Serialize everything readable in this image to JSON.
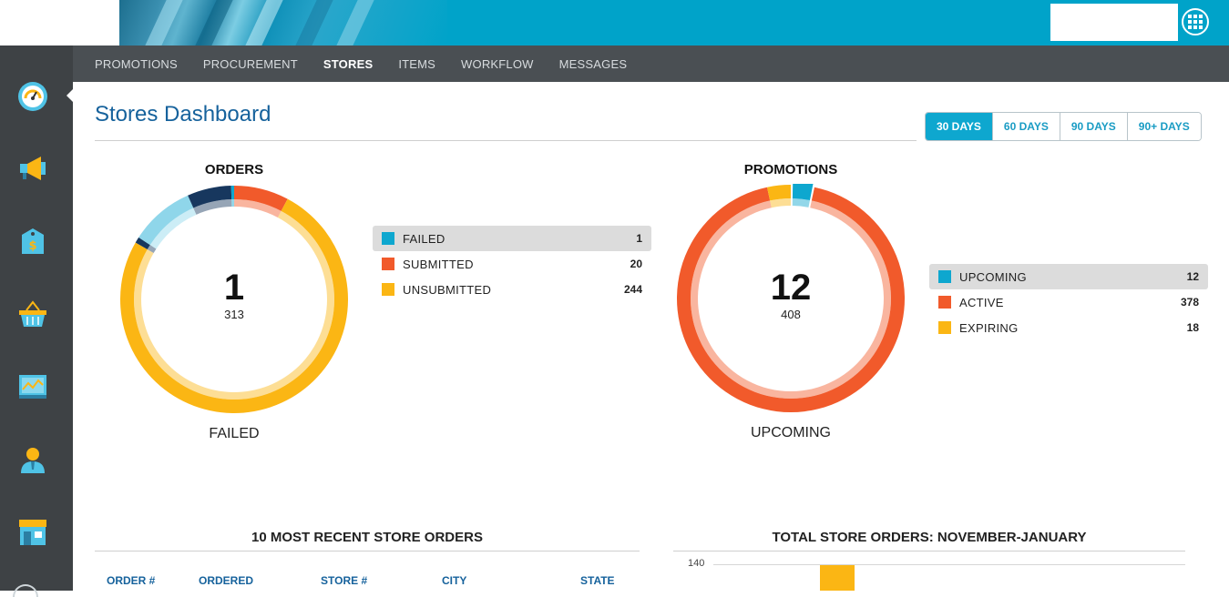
{
  "nav": {
    "items": [
      {
        "label": "PROMOTIONS",
        "active": false
      },
      {
        "label": "PROCUREMENT",
        "active": false
      },
      {
        "label": "STORES",
        "active": true
      },
      {
        "label": "ITEMS",
        "active": false
      },
      {
        "label": "WORKFLOW",
        "active": false
      },
      {
        "label": "MESSAGES",
        "active": false
      }
    ]
  },
  "sidebar": {
    "icons": [
      "dashboard-gauge-icon",
      "megaphone-icon",
      "price-tag-icon",
      "basket-icon",
      "chart-icon",
      "user-icon",
      "store-icon"
    ]
  },
  "page": {
    "title": "Stores Dashboard"
  },
  "range": {
    "options": [
      "30 DAYS",
      "60 DAYS",
      "90 DAYS",
      "90+ DAYS"
    ],
    "selected": "30 DAYS"
  },
  "colors": {
    "blue": "#0ea7cf",
    "orange": "#f15a2b",
    "yellow": "#fbb614",
    "navy": "#17375e",
    "title_blue": "#16629c"
  },
  "orders": {
    "title": "ORDERS",
    "center_value": "1",
    "center_total": "313",
    "bottom_label": "FAILED",
    "legend": [
      {
        "label": "FAILED",
        "value": "1",
        "color": "#0ea7cf",
        "selected": true
      },
      {
        "label": "SUBMITTED",
        "value": "20",
        "color": "#f15a2b",
        "selected": false
      },
      {
        "label": "UNSUBMITTED",
        "value": "244",
        "color": "#fbb614",
        "selected": false
      }
    ]
  },
  "promotions": {
    "title": "PROMOTIONS",
    "center_value": "12",
    "center_total": "408",
    "bottom_label": "UPCOMING",
    "legend": [
      {
        "label": "UPCOMING",
        "value": "12",
        "color": "#0ea7cf",
        "selected": true
      },
      {
        "label": "ACTIVE",
        "value": "378",
        "color": "#f15a2b",
        "selected": false
      },
      {
        "label": "EXPIRING",
        "value": "18",
        "color": "#fbb614",
        "selected": false
      }
    ]
  },
  "recent_orders": {
    "title": "10 MOST RECENT STORE ORDERS",
    "columns": [
      "ORDER #",
      "ORDERED",
      "STORE #",
      "CITY",
      "STATE"
    ]
  },
  "total_orders": {
    "title": "TOTAL STORE ORDERS: NOVEMBER-JANUARY",
    "y_tick": "140"
  }
}
